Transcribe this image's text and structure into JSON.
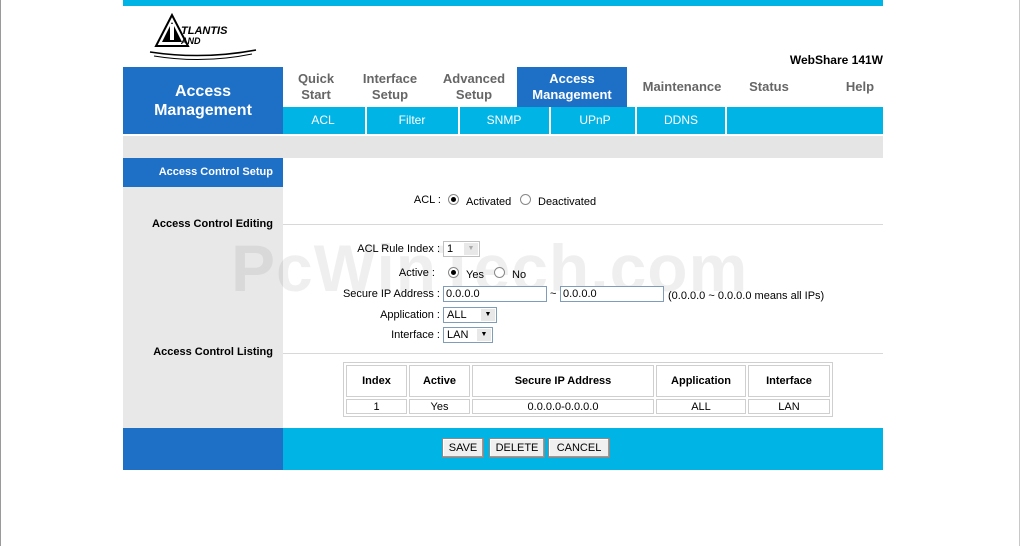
{
  "header": {
    "logo_text": "ATLANTIS LAND",
    "model": "WebShare 141W"
  },
  "nav": {
    "section_title_line1": "Access",
    "section_title_line2": "Management",
    "tabs": [
      {
        "line1": "Quick",
        "line2": "Start"
      },
      {
        "line1": "Interface",
        "line2": "Setup"
      },
      {
        "line1": "Advanced",
        "line2": "Setup"
      },
      {
        "line1": "Access",
        "line2": "Management"
      },
      {
        "line1": "Maintenance",
        "line2": ""
      },
      {
        "line1": "Status",
        "line2": ""
      },
      {
        "line1": "Help",
        "line2": ""
      }
    ],
    "subtabs": [
      "ACL",
      "Filter",
      "SNMP",
      "UPnP",
      "DDNS"
    ]
  },
  "sections": {
    "setup": "Access Control Setup",
    "editing": "Access Control Editing",
    "listing": "Access Control Listing"
  },
  "acl": {
    "label": "ACL :",
    "activated": "Activated",
    "deactivated": "Deactivated",
    "selected": "Activated"
  },
  "editing": {
    "rule_index_label": "ACL Rule Index :",
    "rule_index_value": "1",
    "active_label": "Active :",
    "yes": "Yes",
    "no": "No",
    "secure_ip_label": "Secure IP Address :",
    "ip_start": "0.0.0.0",
    "tilde": "~",
    "ip_end": "0.0.0.0",
    "ip_hint": "(0.0.0.0 ~ 0.0.0.0 means all IPs)",
    "application_label": "Application :",
    "application_value": "ALL",
    "interface_label": "Interface :",
    "interface_value": "LAN"
  },
  "listing": {
    "columns": [
      "Index",
      "Active",
      "Secure IP Address",
      "Application",
      "Interface"
    ],
    "rows": [
      [
        "1",
        "Yes",
        "0.0.0.0-0.0.0.0",
        "ALL",
        "LAN"
      ]
    ]
  },
  "buttons": {
    "save": "SAVE",
    "delete": "DELETE",
    "cancel": "CANCEL"
  },
  "watermark": "PcWinTech.com",
  "colors": {
    "accent_dark_blue": "#1e6fc6",
    "accent_cyan": "#00b4e6",
    "panel_grey": "#e8e8e8"
  }
}
